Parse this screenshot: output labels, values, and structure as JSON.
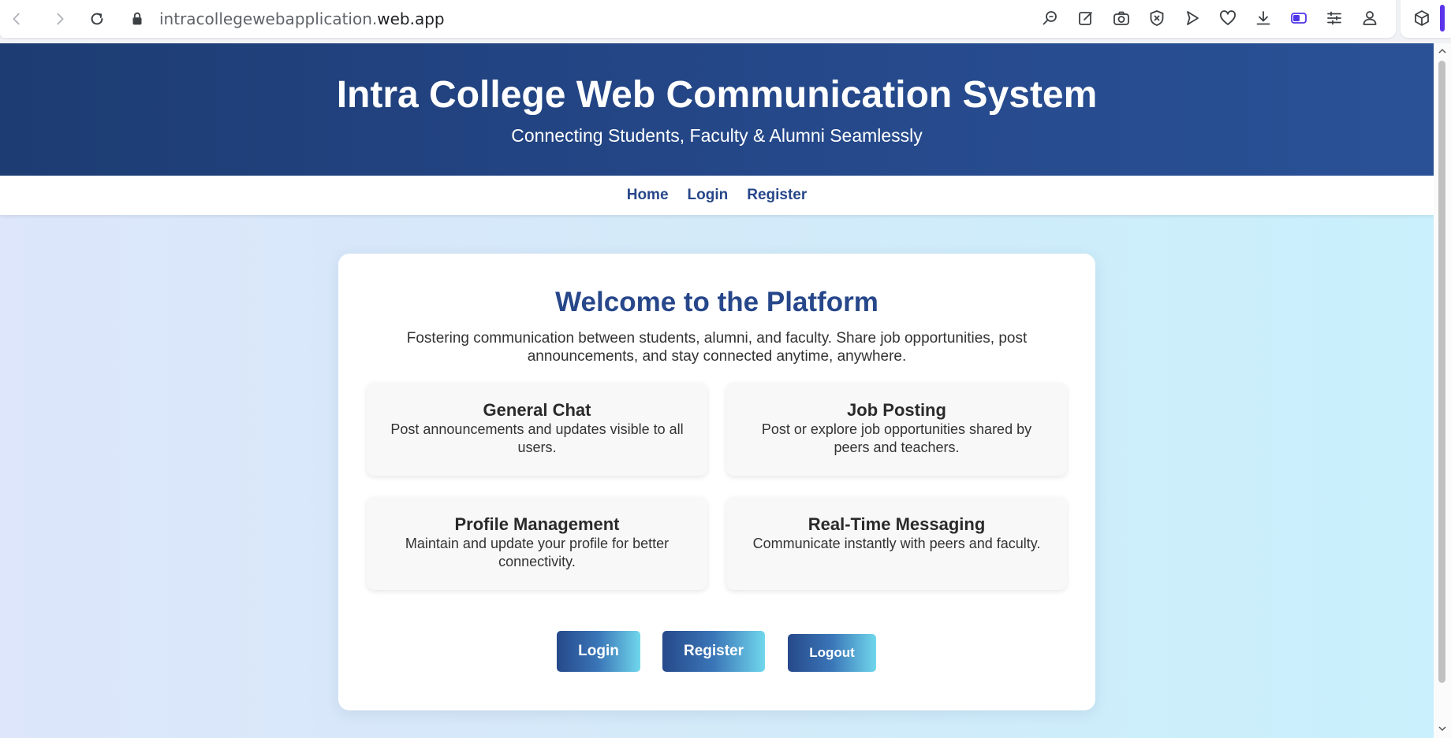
{
  "browser": {
    "url_path": "intracollegewebapplication.",
    "url_domain": "web.app",
    "toolbar_icons": [
      "zoom-icon",
      "edit-icon",
      "camera-icon",
      "shield-icon",
      "send-icon",
      "heart-icon",
      "download-icon",
      "battery-icon",
      "menu-icon",
      "account-icon",
      "extension-cube-icon"
    ]
  },
  "header": {
    "title": "Intra College Web Communication System",
    "subtitle": "Connecting Students, Faculty & Alumni Seamlessly"
  },
  "nav": {
    "items": [
      "Home",
      "Login",
      "Register"
    ]
  },
  "welcome": {
    "heading": "Welcome to the Platform",
    "intro": "Fostering communication between students, alumni, and faculty. Share job opportunities, post announcements, and stay connected anytime, anywhere."
  },
  "features": [
    {
      "title": "General Chat",
      "description": "Post announcements and updates visible to all users."
    },
    {
      "title": "Job Posting",
      "description": "Post or explore job opportunities shared by peers and teachers."
    },
    {
      "title": "Profile Management",
      "description": "Maintain and update your profile for better connectivity."
    },
    {
      "title": "Real-Time Messaging",
      "description": "Communicate instantly with peers and faculty."
    }
  ],
  "actions": {
    "login": "Login",
    "register": "Register",
    "logout": "Logout"
  },
  "colors": {
    "header_bg": "#25488a",
    "accent": "#27478a",
    "button_gradient_end": "#70d7ec",
    "page_bg_start": "#dde6fb",
    "page_bg_end": "#c9f0fc"
  }
}
